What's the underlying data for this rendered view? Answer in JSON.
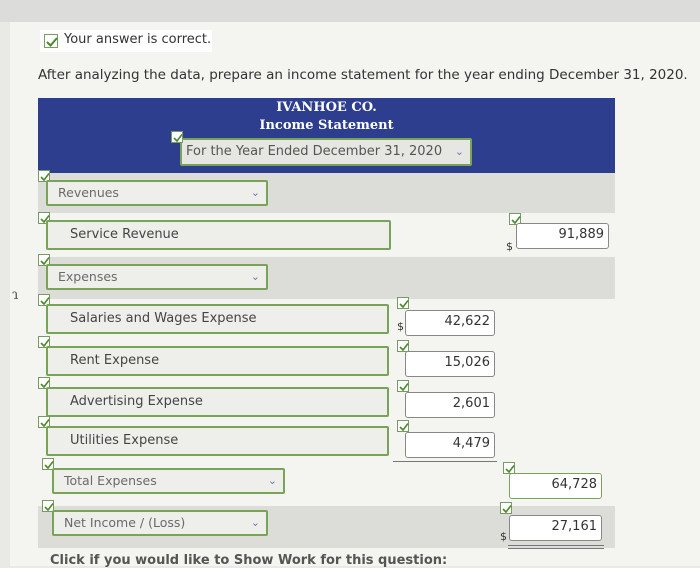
{
  "feedback": "Your answer is correct.",
  "instruction": "After analyzing the data, prepare an income statement for the year ending December 31, 2020.",
  "header": {
    "company": "IVANHOE CO.",
    "statement": "Income Statement",
    "period": "For the Year Ended December 31, 2020"
  },
  "sections": {
    "revenues": "Revenues",
    "expenses": "Expenses",
    "total_expenses": "Total Expenses",
    "net_income": "Net Income / (Loss)"
  },
  "revenue_item": {
    "label": "Service Revenue",
    "currency": "$",
    "amount": "91,889"
  },
  "expense_items": [
    {
      "label": "Salaries and Wages Expense",
      "currency": "$",
      "amount": "42,622"
    },
    {
      "label": "Rent Expense",
      "amount": "15,026"
    },
    {
      "label": "Advertising Expense",
      "amount": "2,601"
    },
    {
      "label": "Utilities Expense",
      "amount": "4,479"
    }
  ],
  "totals": {
    "total_expenses": "64,728",
    "net_income_currency": "$",
    "net_income": "27,161"
  },
  "footer_cta": "Click if you would like to Show Work for this question:",
  "colors": {
    "header_bg": "#2e3e8f",
    "check_green": "#4a8a2a",
    "field_border": "#7aa35a"
  }
}
